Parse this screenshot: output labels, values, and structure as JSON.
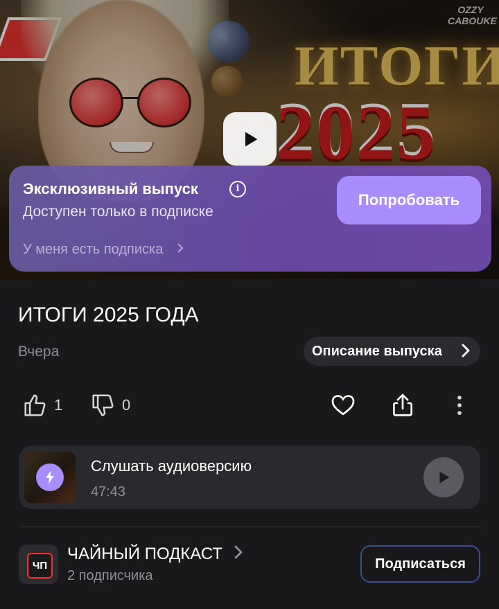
{
  "hero": {
    "headline": "ИТОГИ",
    "year": "2025",
    "watermark": "OZZY CABOUKE"
  },
  "exclusive": {
    "title": "Эксклюзивный выпуск",
    "subtitle": "Доступен только в подписке",
    "try_label": "Попробовать",
    "have_subscription": "У меня есть подписка"
  },
  "episode": {
    "title": "ИТОГИ 2025 ГОДА",
    "date": "Вчера",
    "description_label": "Описание выпуска",
    "likes": "1",
    "dislikes": "0"
  },
  "audio": {
    "title": "Слушать аудиоверсию",
    "duration": "47:43"
  },
  "channel": {
    "name": "ЧАЙНЫЙ ПОДКАСТ",
    "subscribers": "2 подписчика",
    "subscribe_label": "Подписаться"
  },
  "colors": {
    "accent": "#a98dff",
    "background": "#19191b",
    "card": "#2a2a2e",
    "subscribe_border": "#3b4d8f"
  },
  "icons": [
    "play-icon",
    "info-icon",
    "chevron-right-icon",
    "thumbs-up-icon",
    "thumbs-down-icon",
    "heart-icon",
    "share-icon",
    "more-vertical-icon",
    "bolt-icon"
  ]
}
